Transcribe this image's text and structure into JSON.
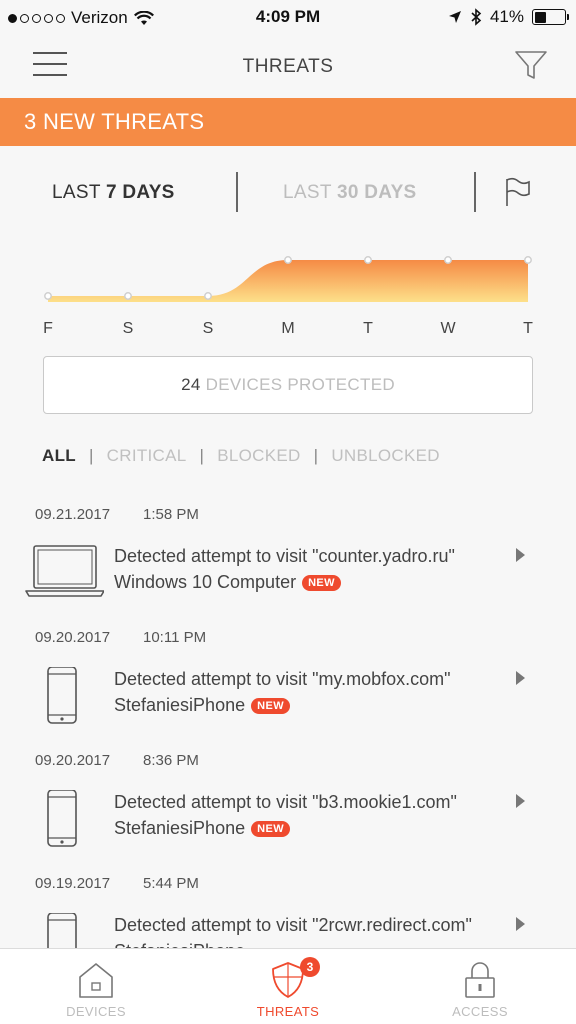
{
  "status_bar": {
    "carrier": "Verizon",
    "time": "4:09 PM",
    "battery": "41%"
  },
  "nav": {
    "title": "THREATS"
  },
  "banner": {
    "text": "3 NEW THREATS"
  },
  "range": {
    "active": {
      "prefix": "LAST ",
      "value": "7 DAYS"
    },
    "inactive": {
      "prefix": "LAST ",
      "value": "30 DAYS"
    }
  },
  "chart_data": {
    "type": "area",
    "categories": [
      "F",
      "S",
      "S",
      "M",
      "T",
      "W",
      "T"
    ],
    "values": [
      0,
      0,
      0,
      1,
      1,
      1,
      1
    ],
    "ylim": [
      0,
      1
    ],
    "grid": false,
    "colors": {
      "top": "#f58b45",
      "bottom": "#fde08a",
      "point": "#cfcfcf"
    }
  },
  "devices": {
    "count": "24",
    "label": " DEVICES PROTECTED"
  },
  "filters": [
    "ALL",
    "CRITICAL",
    "BLOCKED",
    "UNBLOCKED"
  ],
  "threats": [
    {
      "date": "09.21.2017",
      "time": "1:58 PM",
      "title": "Detected attempt to visit \"counter.yadro.ru\"",
      "device": "Windows 10 Computer",
      "device_type": "laptop-icon",
      "badge": "NEW"
    },
    {
      "date": "09.20.2017",
      "time": "10:11 PM",
      "title": "Detected attempt to visit \"my.mobfox.com\"",
      "device": "StefaniesiPhone",
      "device_type": "phone-icon",
      "badge": "NEW"
    },
    {
      "date": "09.20.2017",
      "time": "8:36 PM",
      "title": "Detected attempt to visit \"b3.mookie1.com\"",
      "device": "StefaniesiPhone",
      "device_type": "phone-icon",
      "badge": "NEW"
    },
    {
      "date": "09.19.2017",
      "time": "5:44 PM",
      "title": "Detected attempt to visit \"2rcwr.redirect.com\"",
      "device": "StefaniesiPhone",
      "device_type": "phone-icon",
      "badge": ""
    }
  ],
  "tabbar": {
    "devices": "DEVICES",
    "threats": "THREATS",
    "threats_badge": "3",
    "access": "ACCESS"
  },
  "colors": {
    "accent": "#f58b45",
    "alert": "#ef4a2e"
  }
}
